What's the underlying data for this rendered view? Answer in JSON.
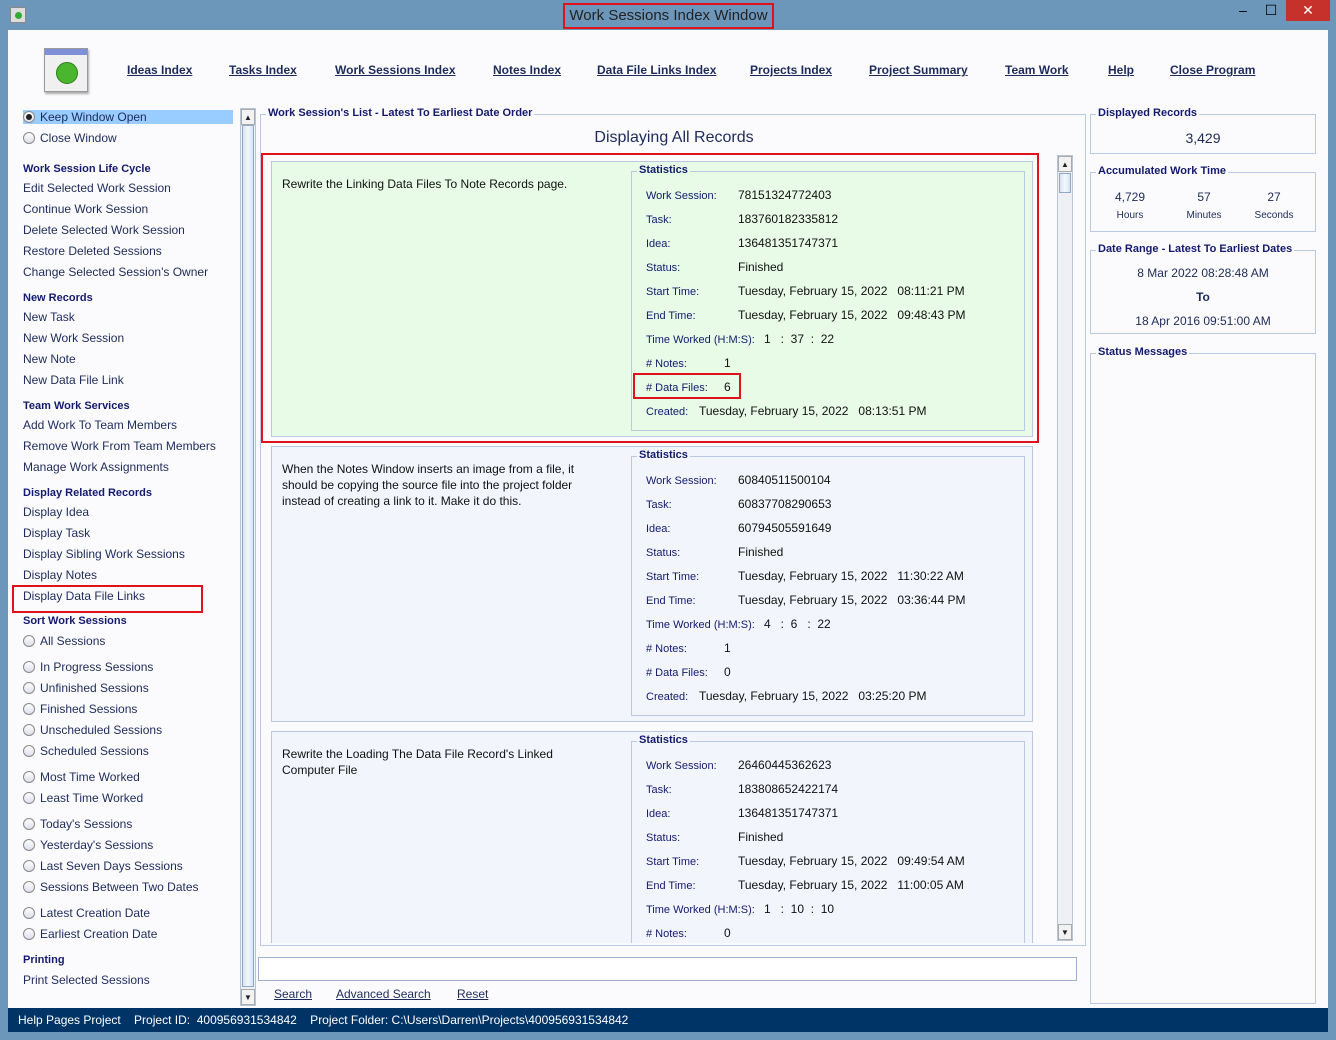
{
  "window": {
    "title": "Work Sessions Index Window",
    "minimize": "‒",
    "maximize": "☐",
    "close": "✕"
  },
  "menu": [
    "Ideas Index",
    "Tasks Index",
    "Work Sessions Index",
    "Notes Index",
    "Data File Links Index",
    "Projects Index",
    "Project Summary",
    "Team Work",
    "Help",
    "Close Program"
  ],
  "sidebar": {
    "window_options": [
      {
        "label": "Keep Window Open",
        "selected": true
      },
      {
        "label": "Close Window",
        "selected": false
      }
    ],
    "groups": [
      {
        "heading": "Work Session Life Cycle",
        "items": [
          "Edit Selected Work Session",
          "Continue Work Session",
          "Delete Selected Work Session",
          "Restore Deleted Sessions",
          "Change Selected Session's Owner"
        ]
      },
      {
        "heading": "New Records",
        "items": [
          "New Task",
          "New Work Session",
          "New Note",
          "New Data File Link"
        ]
      },
      {
        "heading": "Team Work Services",
        "items": [
          "Add Work To Team Members",
          "Remove Work From Team Members",
          "Manage Work Assignments"
        ]
      },
      {
        "heading": "Display Related Records",
        "items": [
          "Display Idea",
          "Display Task",
          "Display Sibling Work Sessions",
          "Display Notes",
          "Display Data File Links"
        ]
      }
    ],
    "sort": {
      "heading": "Sort Work Sessions",
      "radio_groups": [
        [
          "All Sessions"
        ],
        [
          "In Progress Sessions",
          "Unfinished Sessions",
          "Finished Sessions",
          "Unscheduled Sessions",
          "Scheduled Sessions"
        ],
        [
          "Most Time Worked",
          "Least Time Worked"
        ],
        [
          "Today's Sessions",
          "Yesterday's Sessions",
          "Last Seven Days Sessions",
          "Sessions Between Two Dates"
        ],
        [
          "Latest Creation Date",
          "Earliest Creation Date"
        ]
      ]
    },
    "printing": {
      "heading": "Printing",
      "items": [
        "Print Selected Sessions"
      ]
    }
  },
  "list": {
    "group_title": "Work Session's List - Latest To Earliest Date Order",
    "heading": "Displaying All Records",
    "stats_title": "Statistics",
    "labels": {
      "session": "Work Session:",
      "task": "Task:",
      "idea": "Idea:",
      "status": "Status:",
      "start": "Start Time:",
      "end": "End Time:",
      "worked": "Time Worked (H:M:S):",
      "notes": "# Notes:",
      "files": "# Data Files:",
      "created": "Created:"
    },
    "records": [
      {
        "description": "Rewrite the Linking Data Files To Note Records page.",
        "session": "78151324772403",
        "task": "183760182335812",
        "idea": "136481351747371",
        "status": "Finished",
        "start": "Tuesday, February 15, 2022   08:11:21 PM",
        "end": "Tuesday, February 15, 2022   09:48:43 PM",
        "worked": "1   :  37  :  22",
        "notes": "1",
        "files": "6",
        "created": "Tuesday, February 15, 2022   08:13:51 PM",
        "selected": true
      },
      {
        "description": "When the Notes Window inserts an image from a file, it should be copying the source file into the project folder instead of creating a link to it. Make it do this.",
        "session": "60840511500104",
        "task": "60837708290653",
        "idea": "60794505591649",
        "status": "Finished",
        "start": "Tuesday, February 15, 2022   11:30:22 AM",
        "end": "Tuesday, February 15, 2022   03:36:44 PM",
        "worked": "4   :  6   :  22",
        "notes": "1",
        "files": "0",
        "created": "Tuesday, February 15, 2022   03:25:20 PM",
        "selected": false
      },
      {
        "description": "Rewrite the Loading The Data File Record's Linked Computer File",
        "session": "26460445362623",
        "task": "183808652422174",
        "idea": "136481351747371",
        "status": "Finished",
        "start": "Tuesday, February 15, 2022   09:49:54 AM",
        "end": "Tuesday, February 15, 2022   11:00:05 AM",
        "worked": "1   :  10  :  10",
        "notes": "0",
        "selected": false
      }
    ]
  },
  "search": {
    "value": "",
    "buttons": [
      "Search",
      "Advanced Search",
      "Reset"
    ]
  },
  "right": {
    "displayed": {
      "title": "Displayed Records",
      "value": "3,429"
    },
    "accumulated": {
      "title": "Accumulated Work Time",
      "hours": "4,729",
      "hours_label": "Hours",
      "minutes": "57",
      "minutes_label": "Minutes",
      "seconds": "27",
      "seconds_label": "Seconds"
    },
    "range": {
      "title": "Date Range - Latest To Earliest Dates",
      "latest": "8 Mar 2022  08:28:48 AM",
      "to": "To",
      "earliest": "18 Apr 2016  09:51:00 AM"
    },
    "status": {
      "title": "Status Messages"
    }
  },
  "statusbar": {
    "text": "Help Pages Project    Project ID:  400956931534842    Project Folder: C:\\Users\\Darren\\Projects\\400956931534842"
  },
  "colors": {
    "accent": "#1d2b5a",
    "selected_card": "#e8fbe6",
    "highlight": "#e0121b",
    "statusbar": "#003466",
    "selected_option": "#99ccff"
  }
}
